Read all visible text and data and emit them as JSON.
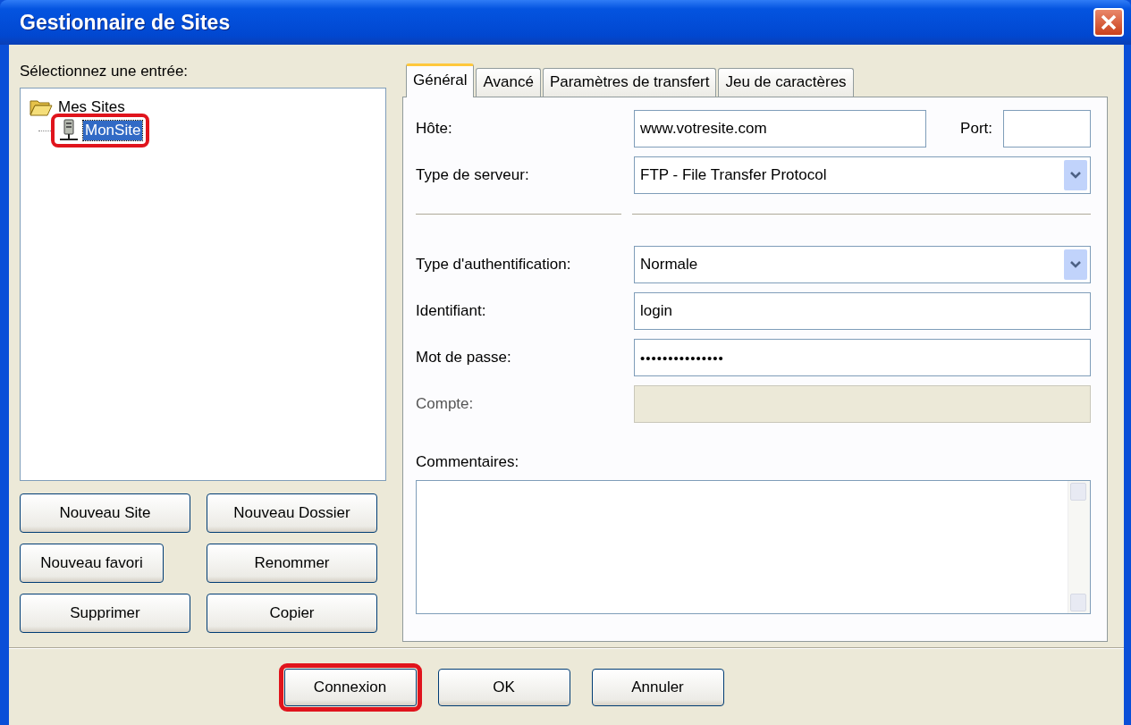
{
  "window": {
    "title": "Gestionnaire de Sites"
  },
  "tree": {
    "label": "Sélectionnez une entrée:",
    "items": [
      {
        "label": "Mes Sites",
        "kind": "folder",
        "expanded": true,
        "selected": false,
        "highlighted": false,
        "children": [
          {
            "label": "MonSite",
            "kind": "site",
            "selected": true,
            "highlighted": true
          }
        ]
      }
    ]
  },
  "tree_buttons": [
    {
      "label": "Nouveau Site",
      "highlighted": false
    },
    {
      "label": "Nouveau Dossier",
      "highlighted": false
    },
    {
      "label": "Nouveau favori",
      "highlighted": false
    },
    {
      "label": "Renommer",
      "highlighted": false
    },
    {
      "label": "Supprimer",
      "highlighted": false
    },
    {
      "label": "Copier",
      "highlighted": false
    }
  ],
  "tabs": [
    {
      "label": "Général",
      "selected": true
    },
    {
      "label": "Avancé",
      "selected": false
    },
    {
      "label": "Paramètres de transfert",
      "selected": false
    },
    {
      "label": "Jeu de caractères",
      "selected": false
    }
  ],
  "fields": [
    {
      "label": "Hôte:",
      "kind": "text",
      "value": "www.votresite.com",
      "disabled": false,
      "extra": {
        "label": "Port:"
      }
    },
    {
      "label": "Type de serveur:",
      "kind": "select",
      "value": "FTP - File Transfer Protocol",
      "disabled": false
    },
    {
      "kind": "separator"
    },
    {
      "label": "Type d'authentification:",
      "kind": "select",
      "value": "Normale",
      "disabled": false
    },
    {
      "label": "Identifiant:",
      "kind": "text",
      "value": "login",
      "disabled": false
    },
    {
      "label": "Mot de passe:",
      "kind": "password",
      "value": "•••••••••••••••",
      "disabled": false
    },
    {
      "label": "Compte:",
      "kind": "text",
      "disabled": true
    }
  ],
  "comments": {
    "label": "Commentaires:"
  },
  "buttons": [
    {
      "label": "Connexion",
      "highlighted": true
    },
    {
      "label": "OK",
      "highlighted": false
    },
    {
      "label": "Annuler",
      "highlighted": false
    }
  ]
}
